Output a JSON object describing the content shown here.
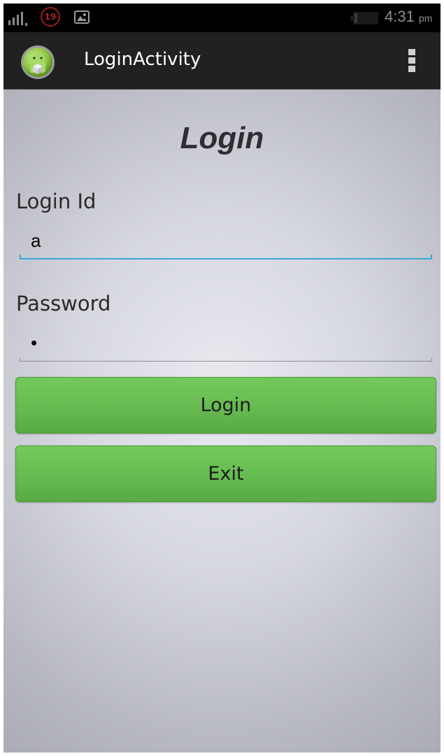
{
  "status_bar": {
    "notification_count": "19",
    "time": "4:31",
    "ampm": "pm",
    "icons": [
      "signal-icon",
      "notification-badge-icon",
      "gallery-icon",
      "battery-icon"
    ]
  },
  "action_bar": {
    "title": "LoginActivity",
    "app_icon": "android-app-icon",
    "overflow_icon": "overflow-menu-icon",
    "color": "#212121"
  },
  "form": {
    "heading": "Login",
    "login_id_label": "Login Id",
    "login_id_value": "a",
    "password_label": "Password",
    "password_value": "•"
  },
  "buttons": {
    "login_label": "Login",
    "exit_label": "Exit"
  },
  "colors": {
    "accent": "#38a8da",
    "button": "#66bb50",
    "badge": "#9c1b1b"
  }
}
